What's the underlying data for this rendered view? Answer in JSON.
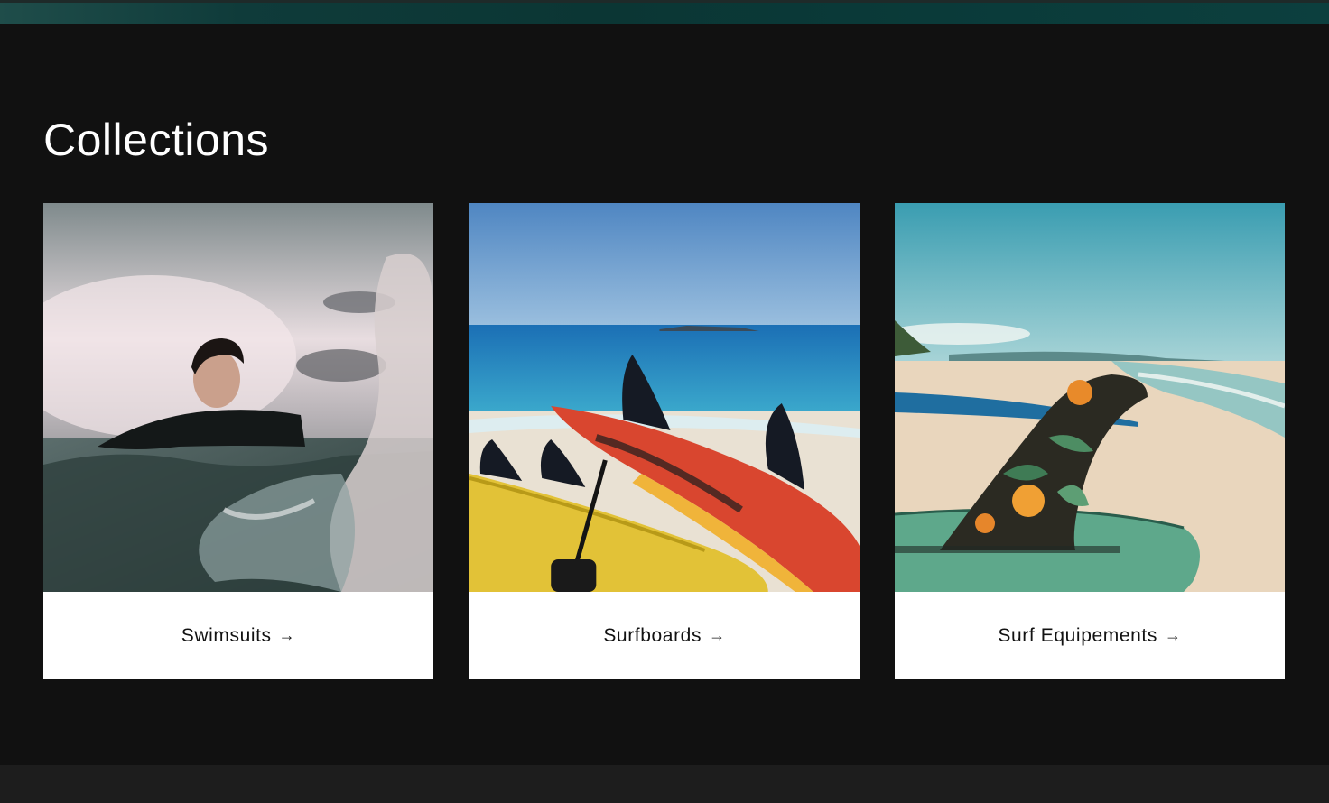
{
  "section": {
    "title": "Collections"
  },
  "collections": [
    {
      "label": "Swimsuits",
      "arrow": "→"
    },
    {
      "label": "Surfboards",
      "arrow": "→"
    },
    {
      "label": "Surf Equipements",
      "arrow": "→"
    }
  ],
  "colors": {
    "background": "#111111",
    "card": "#ffffff",
    "text": "#121212",
    "footer": "#1d1d1d"
  }
}
